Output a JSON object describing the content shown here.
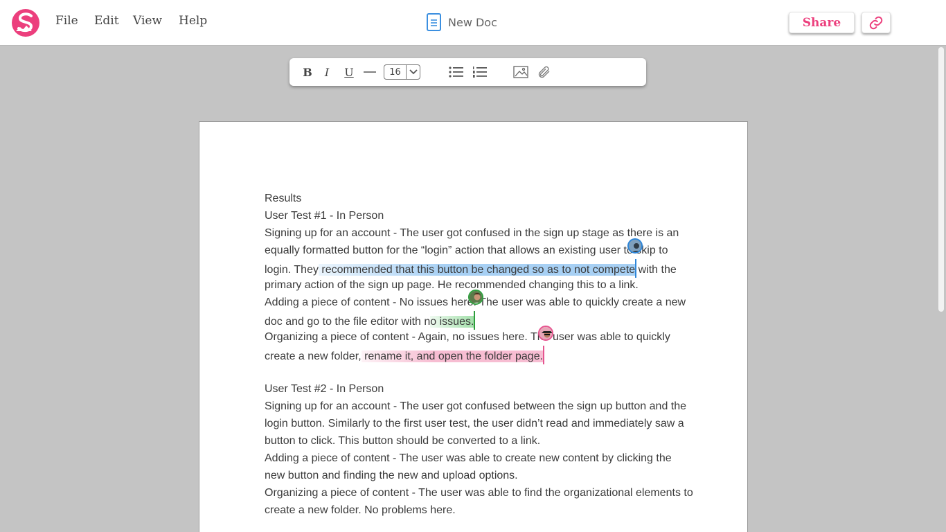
{
  "app": {
    "menu": [
      "File",
      "Edit",
      "View",
      "Help"
    ],
    "doc_title": "New Doc",
    "share_label": "Share",
    "brand_color": "#ec3f7d"
  },
  "toolbar": {
    "bold": "B",
    "italic": "I",
    "underline": "U",
    "font_size": "16",
    "icons": [
      "horizontal-rule-icon",
      "bullet-list-icon",
      "numbered-list-icon",
      "image-icon",
      "paperclip-icon"
    ]
  },
  "document": {
    "lines": [
      {
        "text": "Results"
      },
      {
        "text": "User Test #1 - In Person"
      },
      {
        "text": "Signing up for an account - The user got confused in the sign up stage as there is an"
      },
      {
        "text": "equally formatted button for the “login” action that allows an existing user to skip to"
      },
      {
        "pre": "login. They",
        "hl": " recommended that this button be changed so as to not compete",
        "post": " with the",
        "color": "blue"
      },
      {
        "text": "primary action of the sign up page. He recommended changing this to a link."
      },
      {
        "text": "Adding a piece of content - No issues here. The user was able to quickly create a new"
      },
      {
        "pre": "doc and go to the file editor with n",
        "hl": "o issues.",
        "post": "",
        "color": "green"
      },
      {
        "text": "Organizing a piece of content - Again, no issues here. The user was able to quickly"
      },
      {
        "pre": "create a new folder,",
        "hl": " rename it, and open the folder page.",
        "post": "",
        "color": "pink"
      },
      {
        "text": ""
      },
      {
        "text": "User Test #2 - In Person"
      },
      {
        "text": "Signing up for an account - The user got confused between the sign up button and the"
      },
      {
        "text": "login button. Similarly to the first user test, the user didn’t read and immediately saw a"
      },
      {
        "text": "button to click. This button should be converted to a link."
      },
      {
        "text": "Adding a piece of content - The user was able to create new content by clicking the"
      },
      {
        "text": "new button and finding the new and upload options."
      },
      {
        "text": "Organizing a piece of content - The user was able to find the organizational elements to"
      },
      {
        "text": "create a new folder. No problems here."
      }
    ],
    "collaborators": [
      {
        "name": "collaborator-avatar-blue",
        "color": "#2e86d8"
      },
      {
        "name": "collaborator-avatar-green",
        "color": "#2e9e3d"
      },
      {
        "name": "collaborator-avatar-pink",
        "color": "#e65590"
      }
    ]
  }
}
